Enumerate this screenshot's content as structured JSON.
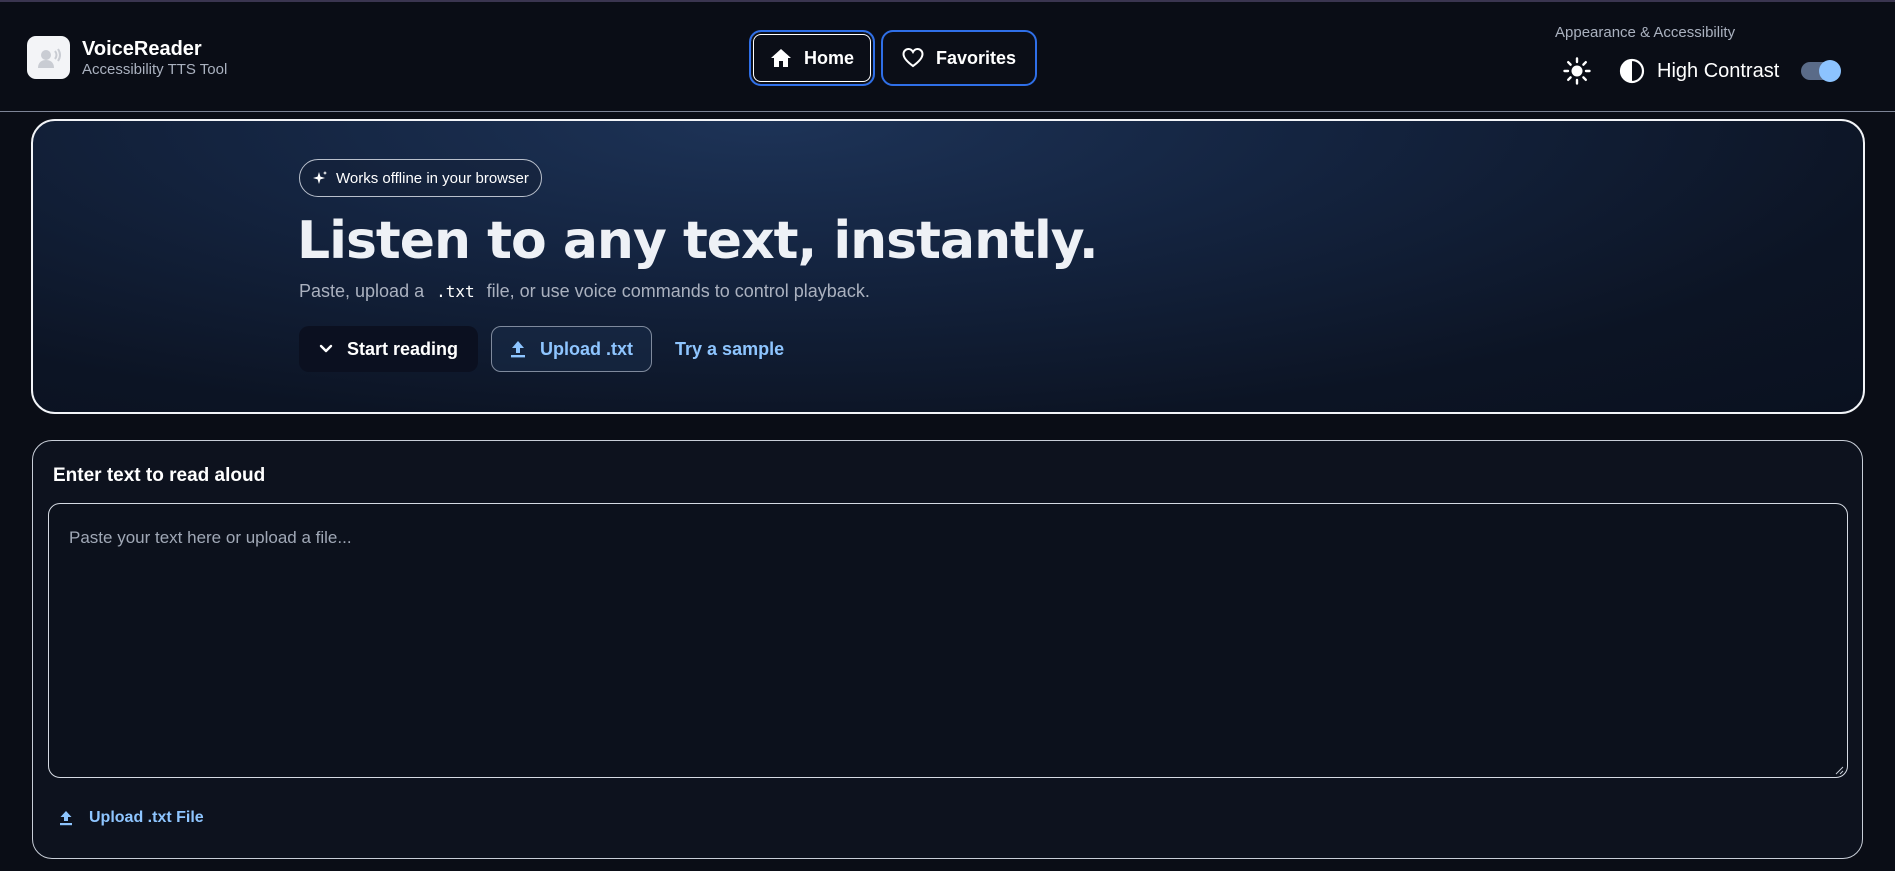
{
  "app": {
    "title": "VoiceReader",
    "subtitle": "Accessibility TTS Tool"
  },
  "nav": {
    "home_label": "Home",
    "favorites_label": "Favorites",
    "active": "Home"
  },
  "appearance": {
    "label": "Appearance & Accessibility",
    "high_contrast_label": "High Contrast",
    "high_contrast_on": true
  },
  "hero": {
    "badge": "Works offline in your browser",
    "title": "Listen to any text, instantly.",
    "subtitle_before": "Paste, upload a",
    "subtitle_code": ".txt",
    "subtitle_after": "file, or use voice commands to control playback.",
    "start_label": "Start reading",
    "upload_label": "Upload .txt",
    "sample_label": "Try a sample"
  },
  "editor": {
    "title": "Enter text to read aloud",
    "placeholder": "Paste your text here or upload a file...",
    "value": "",
    "upload_label": "Upload .txt File"
  },
  "colors": {
    "background": "#0a0d16",
    "accent": "#8ec5ff",
    "nav_border": "#2f6fe8"
  },
  "icons": {
    "logo": "speaker-person-icon",
    "home": "home-icon",
    "favorites": "heart-icon",
    "theme": "sun-icon",
    "contrast": "contrast-icon",
    "badge": "sparkle-icon",
    "start": "chevron-down-icon",
    "upload": "upload-icon"
  }
}
